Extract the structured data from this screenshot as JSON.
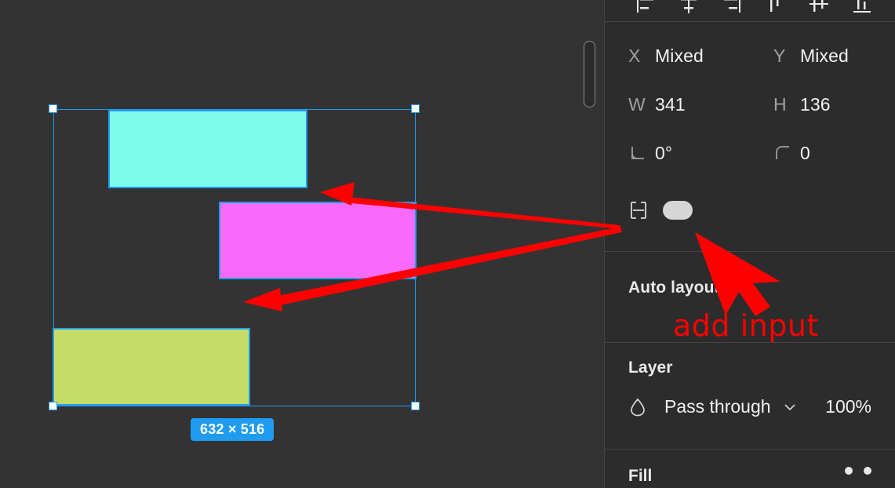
{
  "app": {
    "name": "figma-design-editor",
    "canvas_background": "#333333",
    "panel_background": "#2c2c2c",
    "accent_color": "#1f9cf0",
    "annotation_color": "#ff0000"
  },
  "canvas": {
    "selection": {
      "dimension_badge": "632 × 516",
      "handles": [
        "top-left",
        "top-right",
        "bottom-left",
        "bottom-right"
      ]
    },
    "shapes": [
      {
        "name": "rectangle-cyan",
        "fill": "#7ffbee",
        "stroke": "#1f9cf0"
      },
      {
        "name": "rectangle-magenta",
        "fill": "#f96afc",
        "stroke": "#1f9cf0"
      },
      {
        "name": "rectangle-olive",
        "fill": "#c6dc67",
        "stroke": "#1f9cf0"
      }
    ]
  },
  "right_panel": {
    "align_tools": [
      {
        "name": "align-left-icon",
        "label": "Align left"
      },
      {
        "name": "align-horizontal-centers-icon",
        "label": "Align horizontal centers"
      },
      {
        "name": "align-right-icon",
        "label": "Align right"
      },
      {
        "name": "align-top-icon",
        "label": "Align top"
      },
      {
        "name": "align-vertical-centers-icon",
        "label": "Align vertical centers"
      },
      {
        "name": "align-bottom-icon",
        "label": "Align bottom"
      }
    ],
    "properties": {
      "x_label": "X",
      "x_value": "Mixed",
      "y_label": "Y",
      "y_value": "Mixed",
      "w_label": "W",
      "w_value": "341",
      "h_label": "H",
      "h_value": "136",
      "rotation_value": "0°",
      "corner_radius_value": "0"
    },
    "constraints": {
      "icon_name": "constraints-icon",
      "toggle_state": "on"
    },
    "auto_layout": {
      "title": "Auto layout"
    },
    "layer": {
      "title": "Layer",
      "blend_mode": "Pass through",
      "opacity": "100%"
    },
    "fill": {
      "title": "Fill"
    }
  },
  "annotations": {
    "note": "add input",
    "arrows": 3
  }
}
